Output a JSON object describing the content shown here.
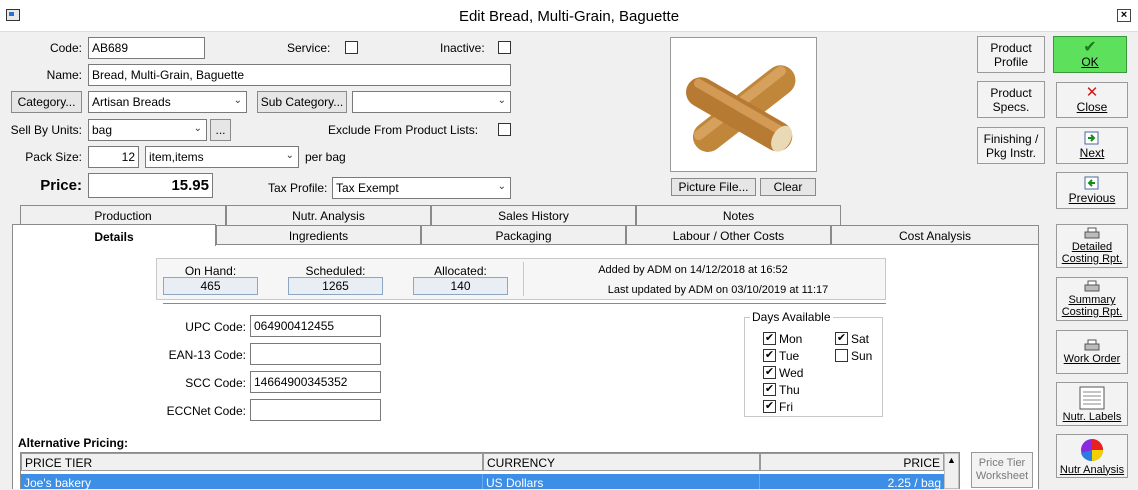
{
  "window": {
    "title": "Edit Bread, Multi-Grain, Baguette"
  },
  "form": {
    "code_label": "Code:",
    "code_value": "AB689",
    "service_label": "Service:",
    "inactive_label": "Inactive:",
    "name_label": "Name:",
    "name_value": "Bread, Multi-Grain, Baguette",
    "category_button": "Category...",
    "category_value": "Artisan Breads",
    "subcategory_button": "Sub Category...",
    "subcategory_value": "",
    "sell_units_label": "Sell By Units:",
    "sell_units_value": "bag",
    "ellipsis": "...",
    "exclude_label": "Exclude From Product Lists:",
    "pack_size_label": "Pack Size:",
    "pack_size_value": "12",
    "pack_unit_value": "item,items",
    "per_bag": "per bag",
    "price_label": "Price:",
    "price_value": "15.95",
    "tax_label": "Tax Profile:",
    "tax_value": "Tax Exempt"
  },
  "picture": {
    "file_button": "Picture File...",
    "clear_button": "Clear"
  },
  "side_buttons": {
    "product_profile": "Product Profile",
    "product_specs": "Product Specs.",
    "finishing": "Finishing / Pkg Instr.",
    "ok": "OK",
    "close": "Close",
    "next": "Next",
    "previous": "Previous",
    "detailed": "Detailed Costing Rpt.",
    "summary": "Summary Costing Rpt.",
    "work_order": "Work Order",
    "nutr_labels": "Nutr. Labels",
    "nutr_analysis": "Nutr Analysis"
  },
  "tabs_top": [
    "Production",
    "Nutr. Analysis",
    "Sales History",
    "Notes"
  ],
  "tabs_bottom": [
    "Details",
    "Ingredients",
    "Packaging",
    "Labour / Other Costs",
    "Cost Analysis"
  ],
  "stock": {
    "on_hand_label": "On Hand:",
    "on_hand": "465",
    "scheduled_label": "Scheduled:",
    "scheduled": "1265",
    "allocated_label": "Allocated:",
    "allocated": "140"
  },
  "audit": {
    "added": "Added by ADM on 14/12/2018 at 16:52",
    "updated": "Last updated by ADM on 03/10/2019 at 11:17"
  },
  "codes": {
    "upc_label": "UPC Code:",
    "upc": "064900412455",
    "ean_label": "EAN-13 Code:",
    "ean": "",
    "scc_label": "SCC Code:",
    "scc": "14664900345352",
    "ecc_label": "ECCNet Code:",
    "ecc": ""
  },
  "days": {
    "title": "Days Available",
    "mon": "Mon",
    "tue": "Tue",
    "wed": "Wed",
    "thu": "Thu",
    "fri": "Fri",
    "sat": "Sat",
    "sun": "Sun",
    "checked_mark": "✔"
  },
  "pricing": {
    "title": "Alternative Pricing:",
    "col_tier": "PRICE TIER",
    "col_currency": "CURRENCY",
    "col_price": "PRICE",
    "row_tier": "Joe's bakery",
    "row_currency": "US Dollars",
    "row_price": "2.25 / bag",
    "worksheet_button": "Price Tier Worksheet"
  },
  "colors": {
    "ok_green": "#5de15d",
    "selection_blue": "#3d8ee6"
  }
}
